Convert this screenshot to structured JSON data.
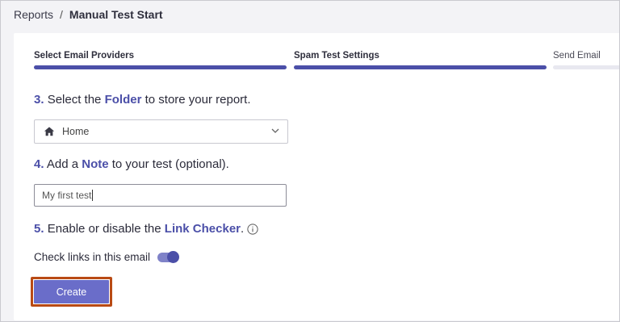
{
  "breadcrumb": {
    "parent": "Reports",
    "separator": "/",
    "current": "Manual Test Start"
  },
  "steps": [
    {
      "label": "Select Email Providers",
      "state": "complete"
    },
    {
      "label": "Spam Test Settings",
      "state": "complete"
    },
    {
      "label": "Send Email",
      "state": "pending"
    }
  ],
  "folder_section": {
    "number": "3.",
    "pre": "Select the",
    "highlight": "Folder",
    "post": "to store your report."
  },
  "folder_select": {
    "icon": "home-icon",
    "value": "Home"
  },
  "note_section": {
    "number": "4.",
    "pre": "Add a",
    "highlight": "Note",
    "post": "to your test (optional)."
  },
  "note_input": {
    "value": "My first test"
  },
  "link_section": {
    "number": "5.",
    "pre": "Enable or disable the",
    "highlight": "Link Checker",
    "post": "."
  },
  "link_toggle": {
    "label": "Check links in this email",
    "enabled": true
  },
  "actions": {
    "create_label": "Create"
  },
  "colors": {
    "accent": "#4b4fa8",
    "button": "#6a6dc9",
    "highlight_border": "#b94a14",
    "background": "#f3f3f6"
  }
}
